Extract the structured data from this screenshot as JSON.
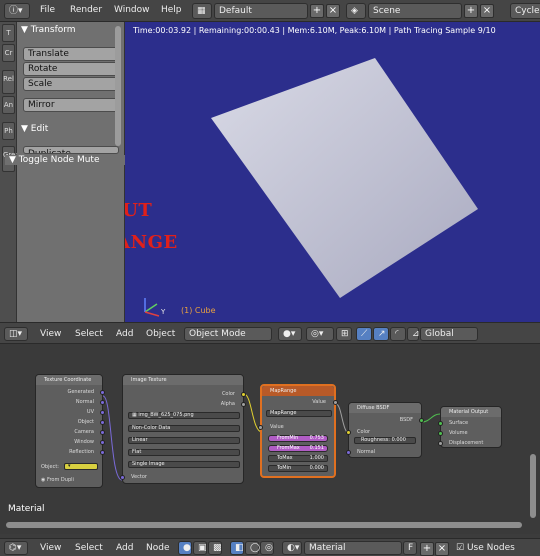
{
  "top_bar": {
    "menus": [
      "File",
      "Render",
      "Window",
      "Help"
    ],
    "layout": "Default",
    "scene": "Scene",
    "engine": "Cycles"
  },
  "tool_tabs": [
    "T",
    "Cr",
    "Rel",
    "An",
    "Ph",
    "Grea"
  ],
  "tool_shelf": {
    "transform_header": "Transform",
    "buttons": [
      "Translate",
      "Rotate",
      "Scale"
    ],
    "mirror": "Mirror",
    "edit_header": "Edit",
    "edit_partial": "Duplicate",
    "toggle_node_mute": "Toggle Node Mute"
  },
  "viewport": {
    "status": "Time:00:03.92 | Remaining:00:00.43 | Mem:6.10M, Peak:6.10M | Path Tracing Sample 9/10",
    "overlay_line1": "WITHOUT",
    "overlay_line2": "MAP RANGE",
    "object_label": "(1) Cube",
    "axis_label": "Y"
  },
  "viewport_header": {
    "menus": [
      "View",
      "Select",
      "Add",
      "Object"
    ],
    "mode": "Object Mode",
    "orientation": "Global"
  },
  "node_editor": {
    "tex_coord": {
      "title": "Texture Coordinate",
      "outputs": [
        "Generated",
        "Normal",
        "UV",
        "Object",
        "Camera",
        "Window",
        "Reflection"
      ],
      "object_label": "Object:",
      "from_dupli": "From Dupli"
    },
    "image_texture": {
      "title": "Image Texture",
      "out_color": "Color",
      "out_alpha": "Alpha",
      "image": "img_BW_625_075.png",
      "color_space": "Non-Color Data",
      "interpolation": "Linear",
      "projection": "Flat",
      "extension": "Single Image",
      "in_vector": "Vector"
    },
    "map_range": {
      "title": "MapRange",
      "out_value": "Value",
      "group": "MapRange",
      "in_value": "Value",
      "fields": [
        {
          "label": "FromMin",
          "value": "0.753"
        },
        {
          "label": "FromMax",
          "value": "0.151"
        },
        {
          "label": "ToMax",
          "value": "1.000"
        },
        {
          "label": "ToMin",
          "value": "0.000"
        }
      ]
    },
    "diffuse": {
      "title": "Diffuse BSDF",
      "out_bsdf": "BSDF",
      "color": "Color",
      "roughness": "Roughness:",
      "roughness_value": "0.000",
      "normal": "Normal"
    },
    "material_output": {
      "title": "Material Output",
      "inputs": [
        "Surface",
        "Volume",
        "Displacement"
      ]
    },
    "material_name": "Material"
  },
  "bottom_header": {
    "menus": [
      "View",
      "Select",
      "Add",
      "Node"
    ],
    "material": "Material",
    "f_label": "F",
    "use_nodes": "Use Nodes"
  },
  "colors": {
    "viewport_bg": "#2c2e8c",
    "overlay_text": "#e0201a",
    "map_range_highlight": "#e07020",
    "socket_yellow": "#e0d030",
    "socket_gray": "#a0a0a0",
    "socket_purple": "#7a6ad8",
    "socket_green": "#50c050"
  }
}
